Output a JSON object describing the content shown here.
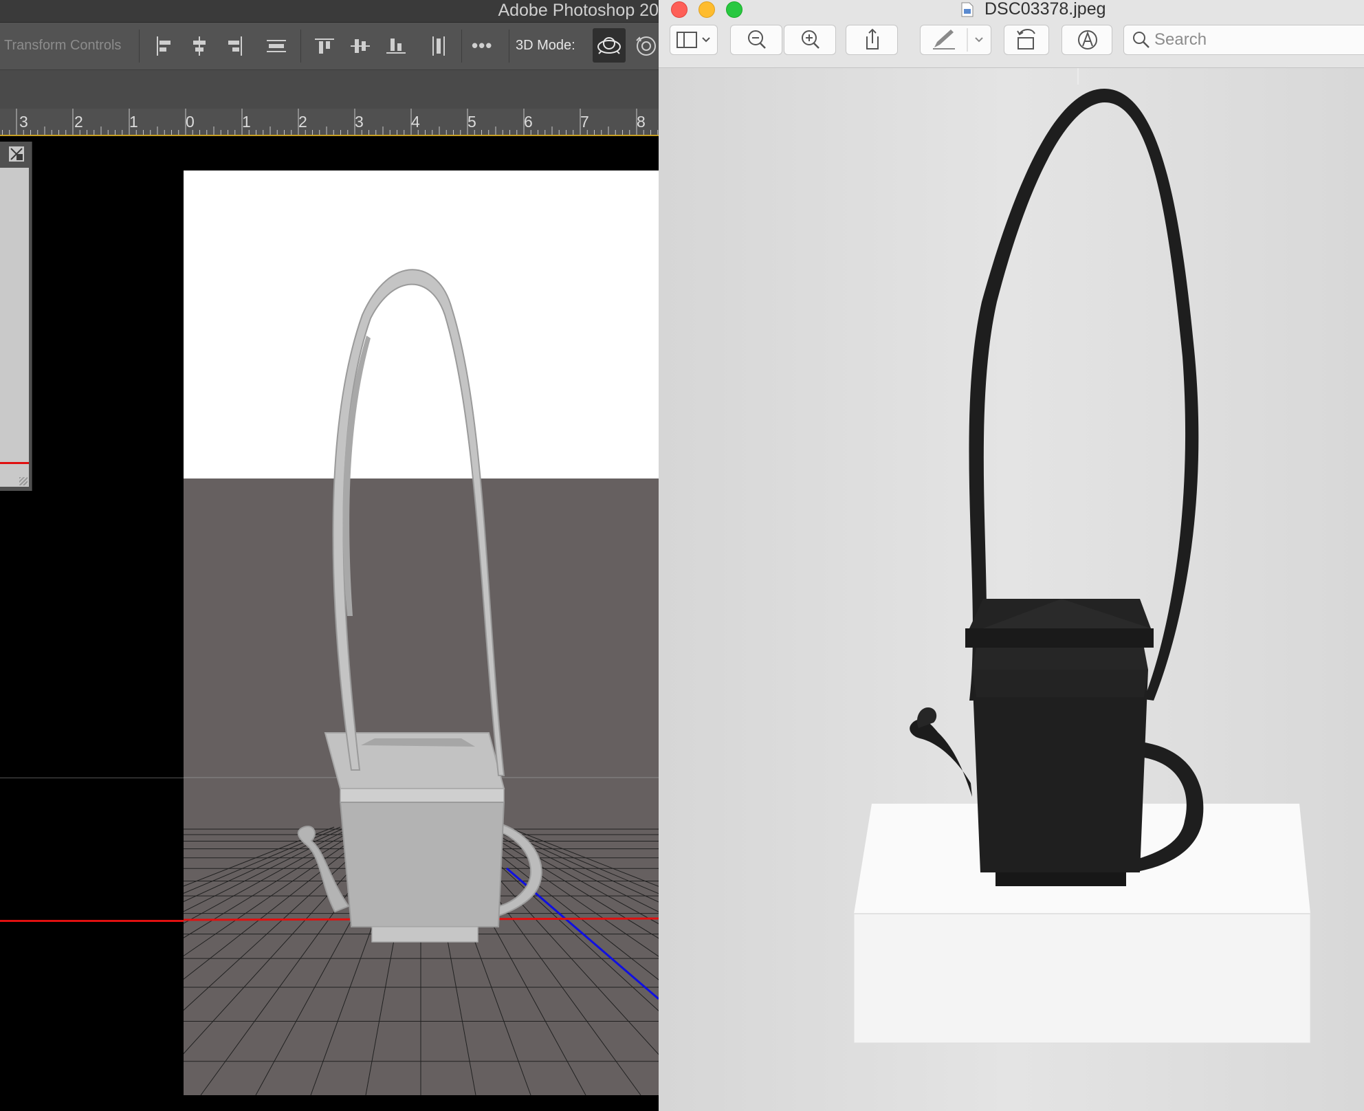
{
  "photoshop": {
    "window_title": "Adobe Photoshop 20",
    "options_bar": {
      "transform_controls_label": "Transform Controls",
      "align_icons": [
        "align-left-edges-icon",
        "align-horizontal-centers-icon",
        "align-right-edges-icon",
        "distribute-horizontal-icon",
        "align-top-edges-icon",
        "align-vertical-centers-icon",
        "align-bottom-edges-icon",
        "distribute-vertical-icon"
      ],
      "more_label": "•••",
      "mode_label": "3D Mode:"
    },
    "ruler": {
      "numbers": [
        "3",
        "2",
        "1",
        "0",
        "1",
        "2",
        "3",
        "4",
        "5",
        "6",
        "7",
        "8"
      ]
    },
    "colors": {
      "options_bar": "#535353",
      "ruler_accent": "#c8a024",
      "canvas_sky": "#ffffff",
      "canvas_floor": "#666060",
      "model": "#b4b4b4",
      "x_axis": "#e01010",
      "z_axis": "#1010e0"
    }
  },
  "preview": {
    "file_name": "DSC03378.jpeg",
    "toolbar_buttons": [
      "sidebar-icon",
      "zoom-out-icon",
      "zoom-in-icon",
      "share-icon",
      "markup-pen-icon",
      "rotate-icon",
      "annotate-icon"
    ],
    "search_placeholder": "Search",
    "colors": {
      "close": "#fe5f57",
      "minimize": "#febc2e",
      "zoom": "#28c840",
      "background": "#e2e2e2",
      "teapot": "#1c1c1c",
      "pedestal": "#f7f7f7"
    }
  }
}
